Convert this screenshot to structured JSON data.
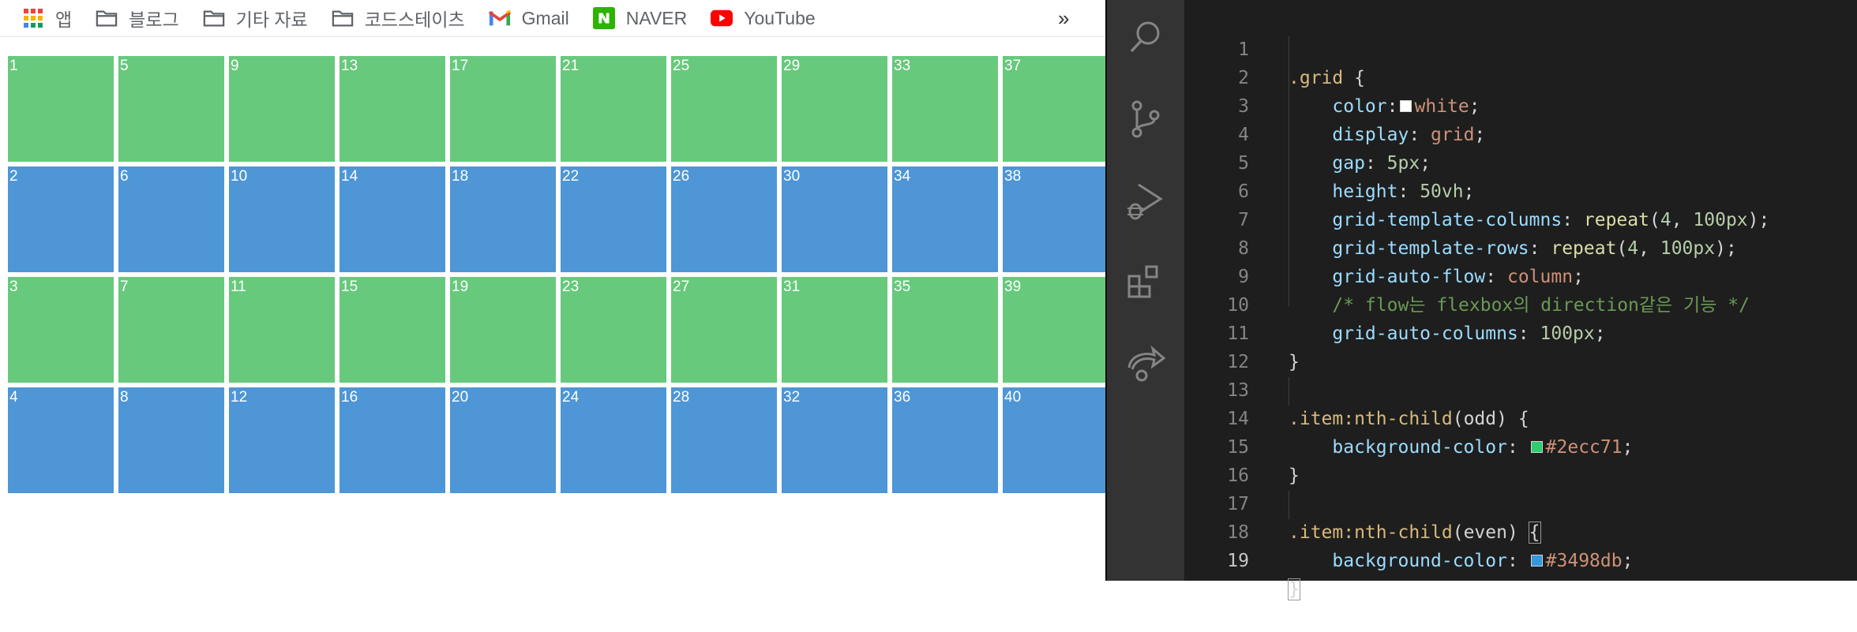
{
  "bookmarks": [
    {
      "label": "앱",
      "icon": "apps-grid-icon"
    },
    {
      "label": "블로그",
      "icon": "folder-icon"
    },
    {
      "label": "기타 자료",
      "icon": "folder-icon"
    },
    {
      "label": "코드스테이츠",
      "icon": "folder-icon"
    },
    {
      "label": "Gmail",
      "icon": "gmail-icon"
    },
    {
      "label": "NAVER",
      "icon": "naver-icon"
    },
    {
      "label": "YouTube",
      "icon": "youtube-icon"
    }
  ],
  "bookmarks_more": "»",
  "grid_items": [
    "1",
    "2",
    "3",
    "4",
    "5",
    "6",
    "7",
    "8",
    "9",
    "10",
    "11",
    "12",
    "13",
    "14",
    "15",
    "16",
    "17",
    "18",
    "19",
    "20",
    "21",
    "22",
    "23",
    "24",
    "25",
    "26",
    "27",
    "28",
    "29",
    "30",
    "31",
    "32",
    "33",
    "34",
    "35",
    "36",
    "37",
    "38",
    "39",
    "40"
  ],
  "colors": {
    "odd": "#67c97c",
    "even": "#4e96d6",
    "swatch_white": "#ffffff",
    "swatch_green": "#2ecc71",
    "swatch_blue": "#3498db"
  },
  "activity_bar": [
    {
      "name": "search-icon"
    },
    {
      "name": "source-control-icon"
    },
    {
      "name": "run-debug-icon"
    },
    {
      "name": "extensions-icon"
    },
    {
      "name": "live-share-icon"
    }
  ],
  "code": {
    "line_numbers": [
      "1",
      "2",
      "3",
      "4",
      "5",
      "6",
      "7",
      "8",
      "9",
      "10",
      "11",
      "12",
      "13",
      "14",
      "15",
      "16",
      "17",
      "18",
      "19"
    ],
    "l1_sel": ".grid",
    "l1_brace": " {",
    "l2_prop": "color",
    "l2_val": "white",
    "l3_prop": "display",
    "l3_val": "grid",
    "l4_prop": "gap",
    "l4_val": "5px",
    "l5_prop": "height",
    "l5_val": "50vh",
    "l6_prop": "grid-template-columns",
    "l6_fn": "repeat",
    "l6_args_a": "4",
    "l6_args_b": "100px",
    "l7_prop": "grid-template-rows",
    "l7_fn": "repeat",
    "l7_args_a": "4",
    "l7_args_b": "100px",
    "l8_prop": "grid-auto-flow",
    "l8_val": "column",
    "l9_comment": "/* flow는 flexbox의 direction같은 기능 */",
    "l10_prop": "grid-auto-columns",
    "l10_val": "100px",
    "l11": "}",
    "l13_sel": ".item:nth-child",
    "l13_arg": "(odd)",
    "l13_brace": " {",
    "l14_prop": "background-color",
    "l14_val": "#2ecc71",
    "l15": "}",
    "l17_sel": ".item:nth-child",
    "l17_arg": "(even)",
    "l17_brace": "{",
    "l18_prop": "background-color",
    "l18_val": "#3498db",
    "l19": "}"
  }
}
